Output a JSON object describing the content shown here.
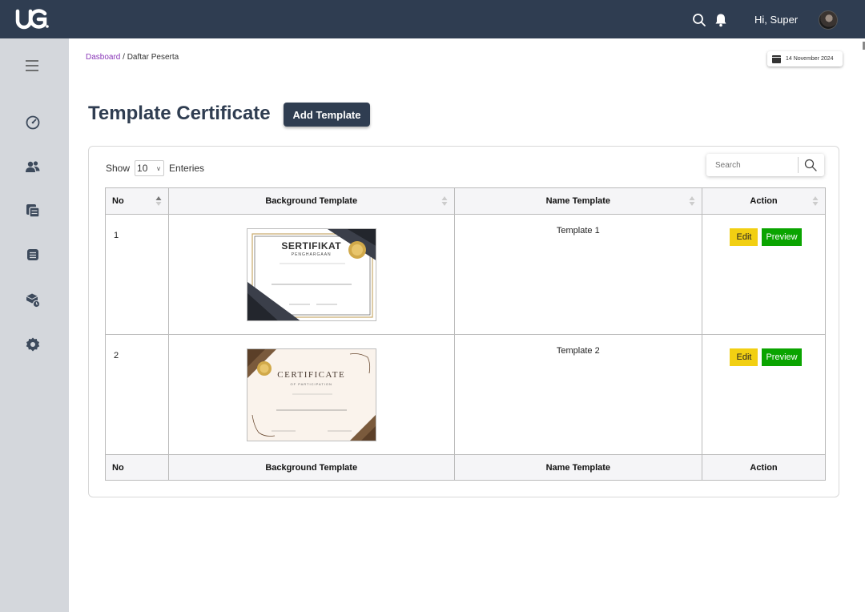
{
  "topbar": {
    "logo_text": "UG",
    "greeting": "Hi, Super"
  },
  "breadcrumb": {
    "parent": "Dasboard",
    "separator": " / ",
    "current": "Daftar Peserta"
  },
  "date": "14 November 2024",
  "page_title": "Template Certificate",
  "add_button_label": "Add Template",
  "entries": {
    "show_label": "Show",
    "selected_value": "10",
    "suffix_label": "Enteries"
  },
  "search": {
    "placeholder": "Search"
  },
  "table": {
    "columns": [
      "No",
      "Background Template",
      "Name Template",
      "Action"
    ],
    "rows": [
      {
        "no": "1",
        "name": "Template 1",
        "thumb_title": "SERTIFIKAT",
        "thumb_subtitle": "PENGHARGAAN"
      },
      {
        "no": "2",
        "name": "Template 2",
        "thumb_title": "CERTIFICATE",
        "thumb_subtitle": "OF PARTICIPATION"
      }
    ],
    "edit_label": "Edit",
    "preview_label": "Preview"
  },
  "colors": {
    "topbar": "#2f3d51",
    "sidebar": "#d4d7dc",
    "breadcrumb_link": "#8a38b8",
    "edit_button": "#f2cf12",
    "preview_button": "#0aa400"
  },
  "icons": [
    "search-icon",
    "bell-icon",
    "menu-icon",
    "dashboard-icon",
    "users-icon",
    "documents-icon",
    "list-icon",
    "box-clock-icon",
    "settings-icon",
    "calendar-icon",
    "sort-icon"
  ]
}
